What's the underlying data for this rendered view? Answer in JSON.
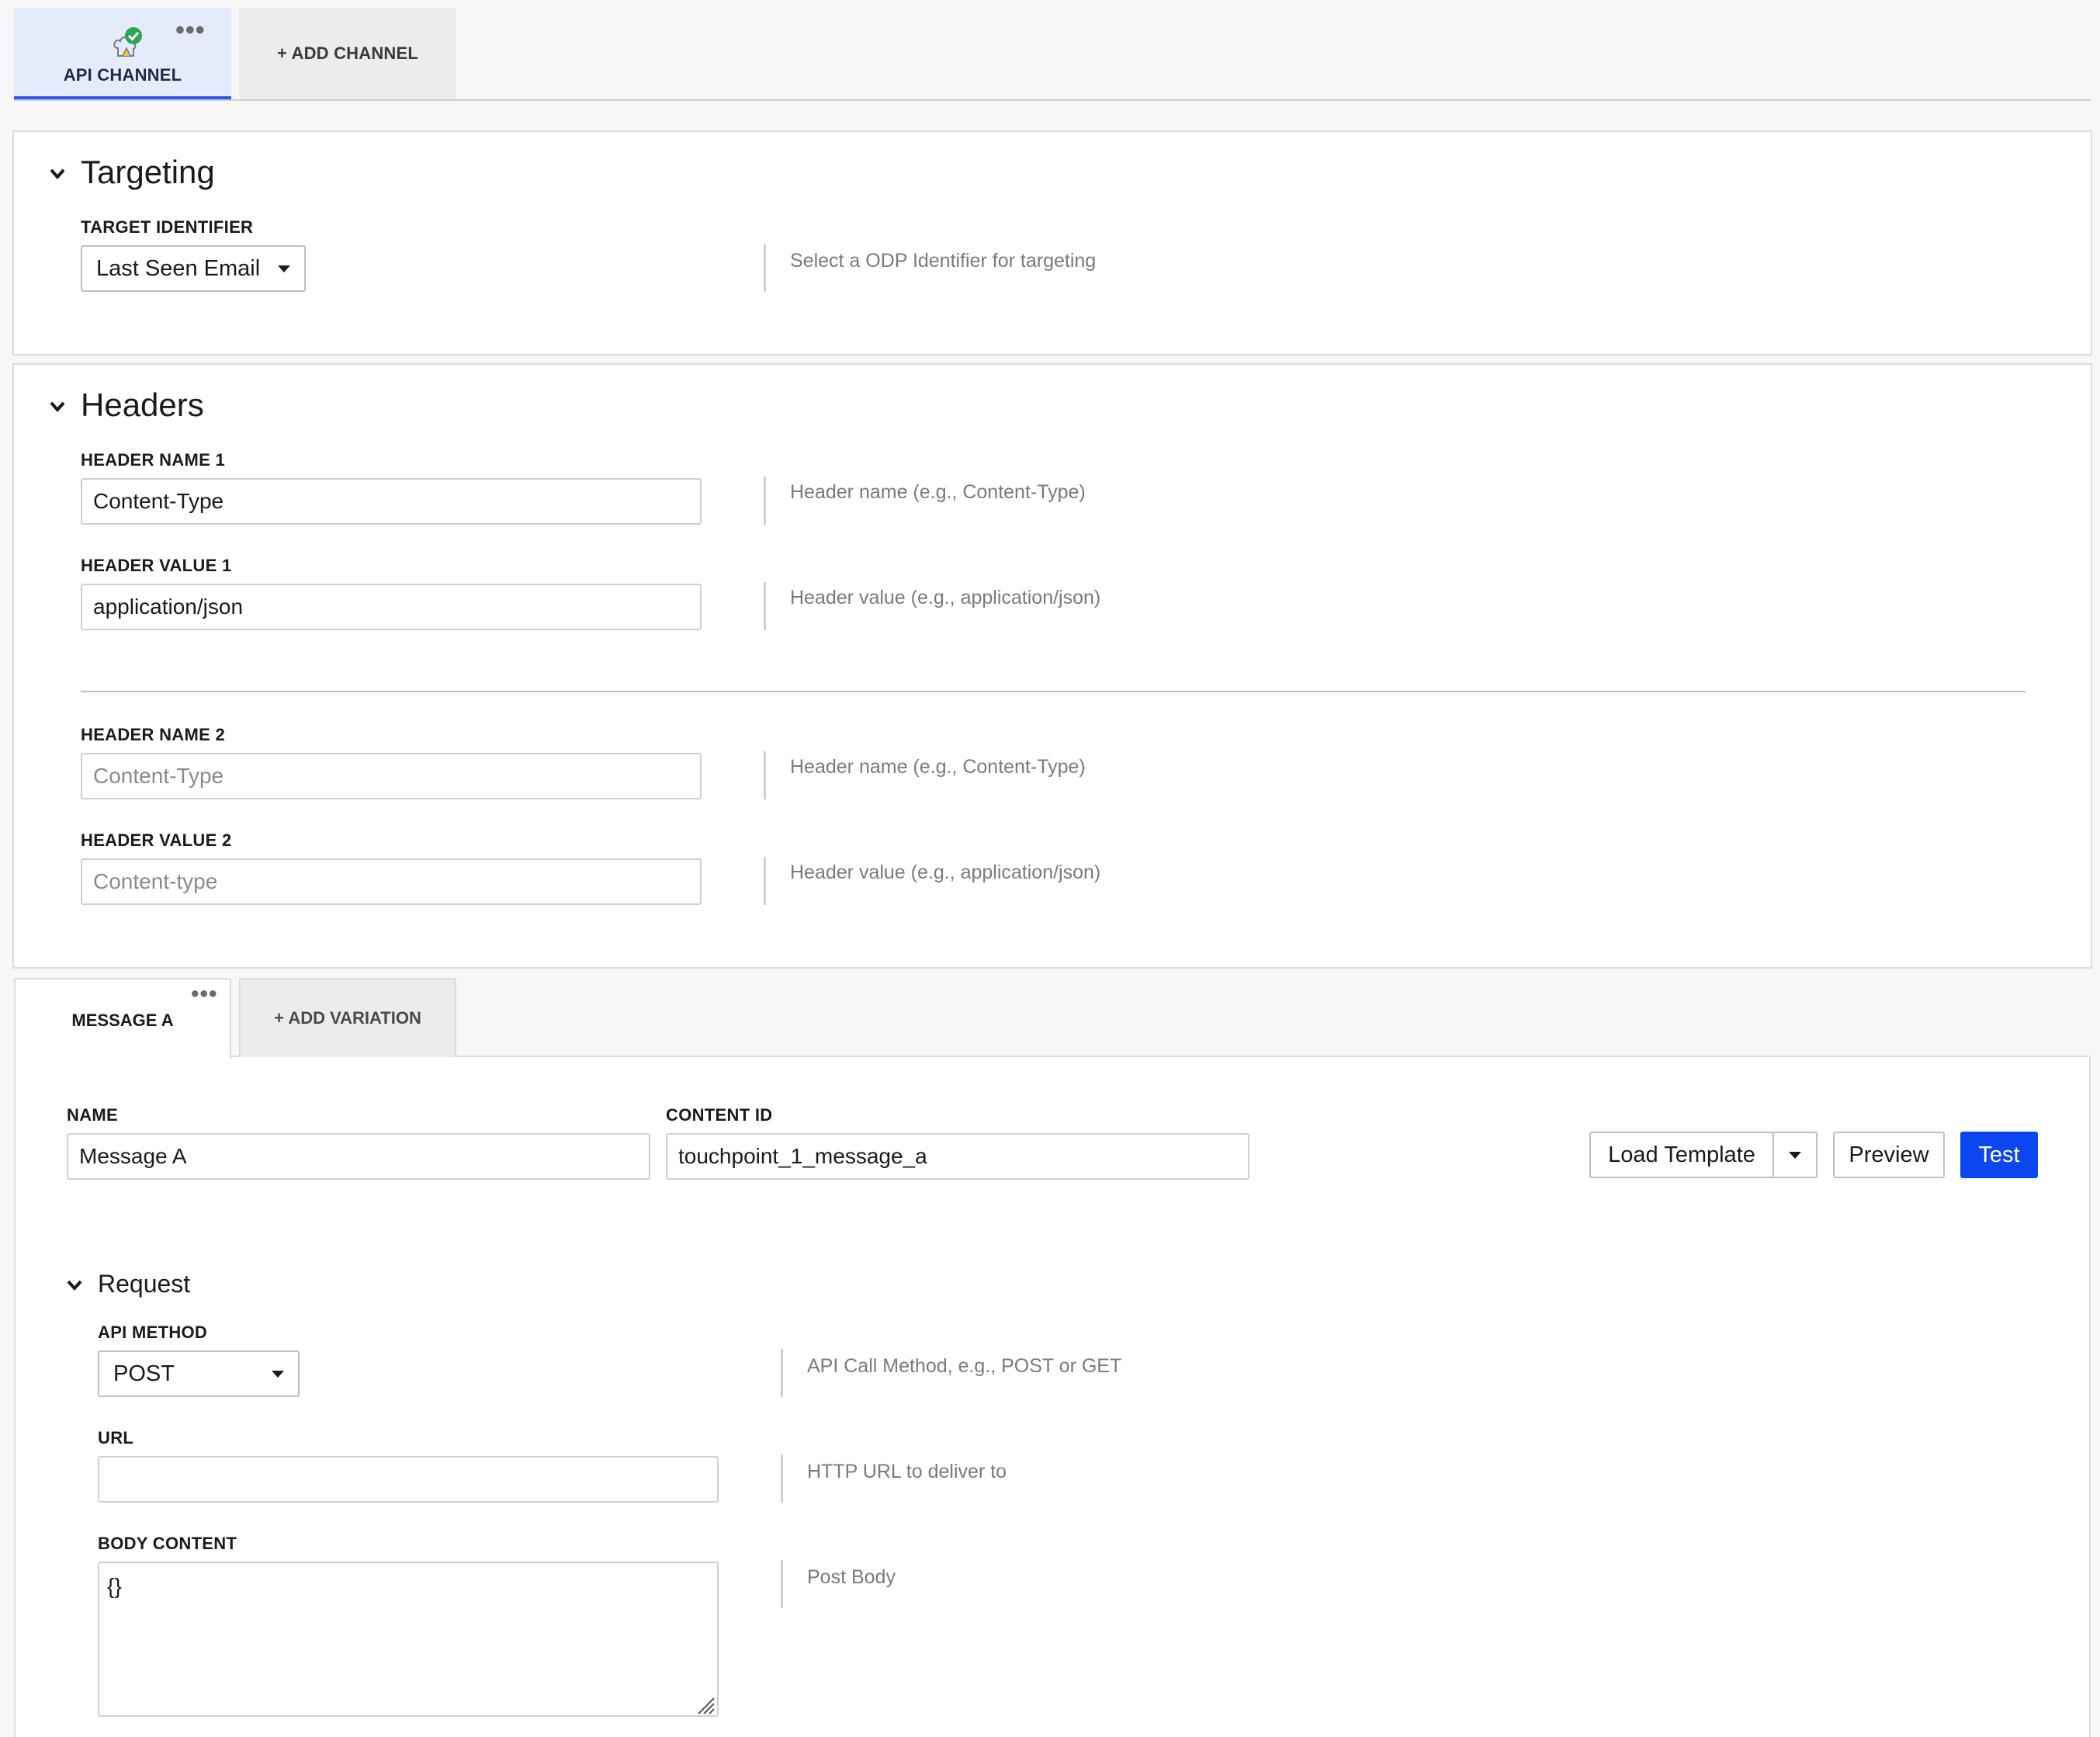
{
  "channel_tabs": {
    "active_label": "API CHANNEL",
    "add_label": "+ ADD CHANNEL",
    "more_glyph": "•••"
  },
  "targeting": {
    "title": "Targeting",
    "target_identifier_label": "TARGET IDENTIFIER",
    "target_identifier_value": "Last Seen Email",
    "target_identifier_help": "Select a ODP Identifier for targeting"
  },
  "headers": {
    "title": "Headers",
    "items": [
      {
        "name_label": "HEADER NAME 1",
        "name_value": "Content-Type",
        "name_placeholder": "",
        "name_help": "Header name (e.g., Content-Type)",
        "value_label": "HEADER VALUE 1",
        "value_value": "application/json",
        "value_placeholder": "",
        "value_help": "Header value (e.g., application/json)"
      },
      {
        "name_label": "HEADER NAME 2",
        "name_value": "",
        "name_placeholder": "Content-Type",
        "name_help": "Header name (e.g., Content-Type)",
        "value_label": "HEADER VALUE 2",
        "value_value": "",
        "value_placeholder": "Content-type",
        "value_help": "Header value (e.g., application/json)"
      }
    ]
  },
  "message_tabs": {
    "active_label": "MESSAGE A",
    "add_label": "+ ADD VARIATION",
    "more_glyph": "•••"
  },
  "message": {
    "name_label": "NAME",
    "name_value": "Message A",
    "content_id_label": "CONTENT ID",
    "content_id_value": "touchpoint_1_message_a",
    "load_template_label": "Load Template",
    "preview_label": "Preview",
    "test_label": "Test"
  },
  "request": {
    "title": "Request",
    "api_method_label": "API METHOD",
    "api_method_value": "POST",
    "api_method_help": "API Call Method, e.g., POST or GET",
    "url_label": "URL",
    "url_value": "",
    "url_help": "HTTP URL to deliver to",
    "body_label": "BODY CONTENT",
    "body_value": "{}",
    "body_help": "Post Body"
  },
  "colors": {
    "accent": "#2b59e6",
    "primary_button": "#0b46f0",
    "active_tab_bg": "#e6ebfb",
    "success_check": "#2ea44f"
  },
  "icons": {
    "channel_icon": "api-cloud-check-icon",
    "collapse_icon": "chevron-down-icon",
    "dropdown_icon": "caret-down-icon",
    "more_icon": "more-horizontal-icon"
  }
}
